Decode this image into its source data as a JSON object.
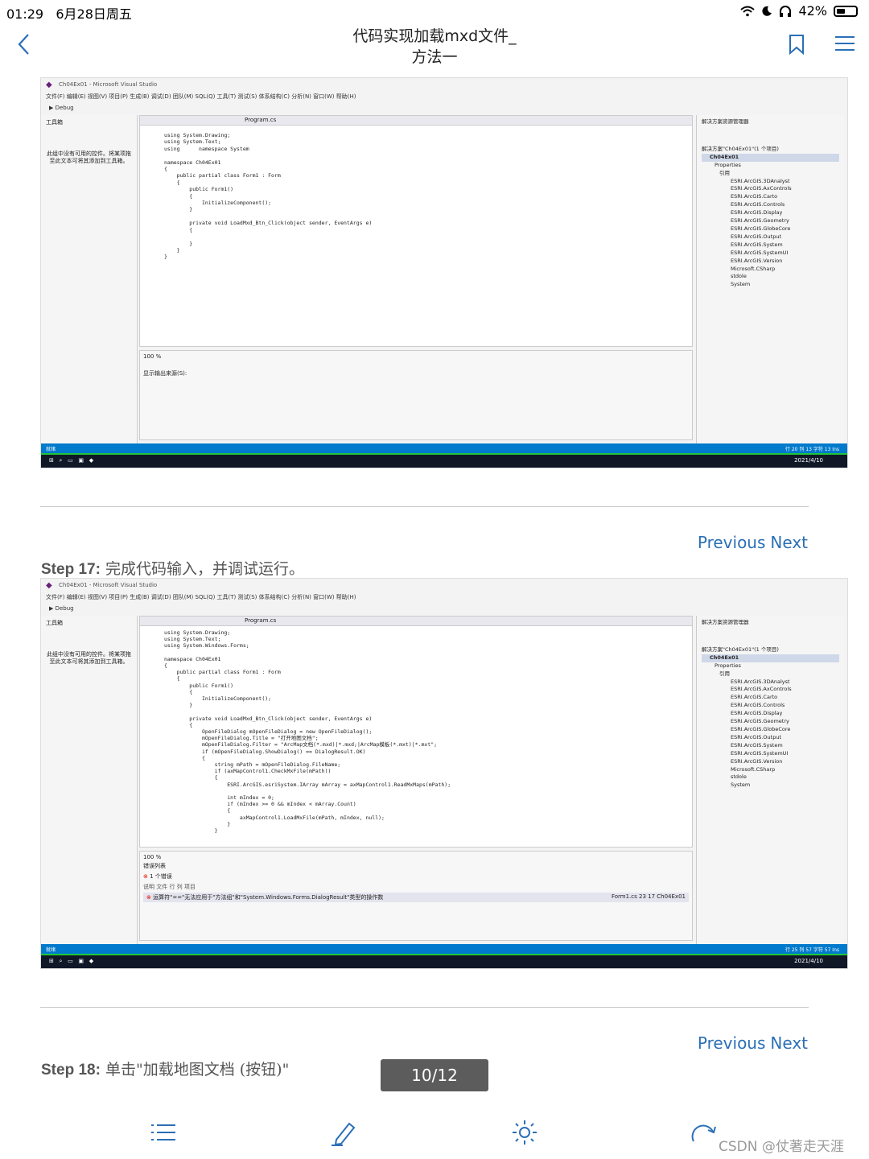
{
  "status": {
    "time": "01:29",
    "date": "6月28日周五",
    "battery": "42%"
  },
  "nav": {
    "title_line1": "代码实现加载mxd文件_",
    "title_line2": "方法一"
  },
  "shot1": {
    "window_title": "Ch04Ex01 - Microsoft Visual Studio",
    "menu": "文件(F)   编辑(E)   视图(V)   项目(P)   生成(B)   调试(D)   团队(M)   SQL(Q)   工具(T)   测试(S)   体系结构(C)   分析(N)   窗口(W)   帮助(H)",
    "toolbar": "Debug",
    "tab": "Program.cs",
    "left_panel": "工具箱",
    "left_note": "此组中没有可用的控件。将某项拖至此文本可将其添加到工具箱。",
    "code": "using System.Drawing;\nusing System.Text;\nusing      namespace System\n\nnamespace Ch04Ex01\n{\n    public partial class Form1 : Form\n    {\n        public Form1()\n        {\n            InitializeComponent();\n        }\n\n        private void LoadMxd_Btn_Click(object sender, EventArgs e)\n        {\n\n        }\n    }\n}",
    "zoom": "100 %",
    "output_label": "显示输出来源(S):",
    "solution_title": "解决方案资源管理器",
    "solution_items": [
      "解决方案\"Ch04Ex01\"(1 个项目)",
      "Ch04Ex01",
      "Properties",
      "引用",
      "ESRI.ArcGIS.3DAnalyst",
      "ESRI.ArcGIS.AxControls",
      "ESRI.ArcGIS.Carto",
      "ESRI.ArcGIS.Controls",
      "ESRI.ArcGIS.Display",
      "ESRI.ArcGIS.Geometry",
      "ESRI.ArcGIS.GlobeCore",
      "ESRI.ArcGIS.Output",
      "ESRI.ArcGIS.System",
      "ESRI.ArcGIS.SystemUI",
      "ESRI.ArcGIS.Version",
      "Microsoft.CSharp",
      "stdole",
      "System"
    ],
    "status_left": "就绪",
    "status_right": "行 20     列 13     字符 13     Ins",
    "taskbar_date": "2021/4/10"
  },
  "prevnext1": {
    "prev": "Previous",
    "next": "Next"
  },
  "step17": {
    "label": "Step 17:",
    "text": " 完成代码输入，并调试运行。"
  },
  "shot2": {
    "window_title": "Ch04Ex01 - Microsoft Visual Studio",
    "menu": "文件(F)   编辑(E)   视图(V)   项目(P)   生成(B)   调试(D)   团队(M)   SQL(Q)   工具(T)   测试(S)   体系结构(C)   分析(N)   窗口(W)   帮助(H)",
    "toolbar": "Debug",
    "tab": "Program.cs",
    "left_panel": "工具箱",
    "left_note": "此组中没有可用的控件。将某项拖至此文本可将其添加到工具箱。",
    "code": "using System.Drawing;\nusing System.Text;\nusing System.Windows.Forms;\n\nnamespace Ch04Ex01\n{\n    public partial class Form1 : Form\n    {\n        public Form1()\n        {\n            InitializeComponent();\n        }\n\n        private void LoadMxd_Btn_Click(object sender, EventArgs e)\n        {\n            OpenFileDialog mOpenFileDialog = new OpenFileDialog();\n            mOpenFileDialog.Title = \"打开地图文档\";\n            mOpenFileDialog.Filter = \"ArcMap文档(*.mxd)|*.mxd;|ArcMap模板(*.mxt)|*.mxt\";\n            if (mOpenFileDialog.ShowDialog() == DialogResult.OK)\n            {\n                string mPath = mOpenFileDialog.FileName;\n                if (axMapControl1.CheckMxFile(mPath))\n                {\n                    ESRI.ArcGIS.esriSystem.IArray mArray = axMapControl1.ReadMxMaps(mPath);\n\n                    int mIndex = 0;\n                    if (mIndex >= 0 && mIndex < mArray.Count)\n                    {\n                        axMapControl1.LoadMxFile(mPath, mIndex, null);\n                    }\n                }",
    "zoom": "100 %",
    "error_list_title": "错误列表",
    "error_filter": "1 个错误",
    "error_cols": "说明                                                            文件         行     列     项目",
    "error_text": "运算符\"==\"无法应用于\"方法组\"和\"System.Windows.Forms.DialogResult\"类型的操作数",
    "error_meta": "Form1.cs     23     17     Ch04Ex01",
    "solution_title": "解决方案资源管理器",
    "solution_items": [
      "解决方案\"Ch04Ex01\"(1 个项目)",
      "Ch04Ex01",
      "Properties",
      "引用",
      "ESRI.ArcGIS.3DAnalyst",
      "ESRI.ArcGIS.AxControls",
      "ESRI.ArcGIS.Carto",
      "ESRI.ArcGIS.Controls",
      "ESRI.ArcGIS.Display",
      "ESRI.ArcGIS.Geometry",
      "ESRI.ArcGIS.GlobeCore",
      "ESRI.ArcGIS.Output",
      "ESRI.ArcGIS.System",
      "ESRI.ArcGIS.SystemUI",
      "ESRI.ArcGIS.Version",
      "Microsoft.CSharp",
      "stdole",
      "System"
    ],
    "status_left": "就绪",
    "status_right": "行 25     列 57     字符 57     Ins",
    "taskbar_date": "2021/4/10"
  },
  "prevnext2": {
    "prev": "Previous",
    "next": "Next"
  },
  "step18": {
    "label": "Step 18:",
    "text": " 单击\"加载地图文档 (按钮)\""
  },
  "pager": "10/12",
  "watermark": "CSDN @仗著走天涯",
  "colors": {
    "link": "#2b6fb6",
    "vs_blue": "#007acc",
    "taskbar": "#101828"
  }
}
